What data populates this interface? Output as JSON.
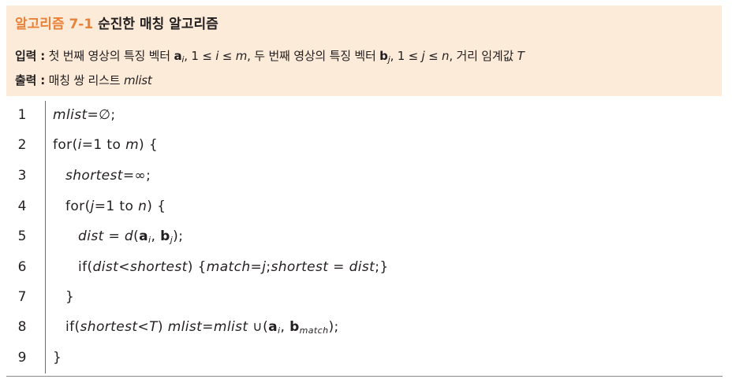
{
  "header": {
    "title_prefix": "알고리즘 7-1",
    "title_text": "순진한 매칭 알고리즘",
    "input_label": "입력 :",
    "input_text_1": "첫 번째 영상의 특징 벡터",
    "input_var_a": "a",
    "input_sub_i": "i",
    "input_range_1": ", 1 ≤ ",
    "input_var_i": "i",
    "input_le_m": " ≤ ",
    "input_var_m": "m",
    "input_text_2": ", 두 번째 영상의 특징 벡터",
    "input_var_b": "b",
    "input_sub_j": "j",
    "input_range_2": ", 1 ≤ ",
    "input_var_j": "j",
    "input_le_n": " ≤ ",
    "input_var_n": "n",
    "input_text_3": ", 거리 임계값",
    "input_var_T": "T",
    "output_label": "출력 :",
    "output_text": "매칭 쌍 리스트",
    "output_var": "mlist"
  },
  "code": {
    "line_numbers": [
      "1",
      "2",
      "3",
      "4",
      "5",
      "6",
      "7",
      "8",
      "9"
    ],
    "l1": {
      "var": "mlist",
      "rest": "=∅;"
    },
    "l2": {
      "a": "for(",
      "i": "i",
      "b": "=1 to ",
      "m": "m",
      "c": ") {"
    },
    "l3": {
      "var": "shortest",
      "rest": "=∞;"
    },
    "l4": {
      "a": "for(",
      "j": "j",
      "b": "=1 to ",
      "n": "n",
      "c": ") {"
    },
    "l5": {
      "dist": "dist",
      "eq": " = ",
      "d": "d",
      "open": "(",
      "a": "a",
      "ai": "i",
      "comma": ", ",
      "b": "b",
      "bj": "j",
      "close": ");"
    },
    "l6": {
      "a": "if(",
      "dist": "dist",
      "lt": "<",
      "shortest": "shortest",
      "b": ") {",
      "match": "match",
      "eq": "=",
      "j": "j",
      "semi": ";",
      "shortest2": "shortest",
      "eq2": " = ",
      "dist2": "dist",
      "c": ";}"
    },
    "l7": {
      "text": "}"
    },
    "l8": {
      "a": "if(",
      "shortest": "shortest",
      "lt": "<",
      "T": "T",
      "b": ") ",
      "mlist": "mlist",
      "eq": "=",
      "mlist2": "mlist",
      "union": " ∪(",
      "va": "a",
      "ai": "i",
      "comma": ", ",
      "vb": "b",
      "bsub": "match",
      "c": ");"
    },
    "l9": {
      "text": "}"
    }
  },
  "colors": {
    "header_bg": "#fcebd9",
    "title_accent": "#e8823a",
    "text": "#231f20",
    "rule": "#6d6e71"
  }
}
